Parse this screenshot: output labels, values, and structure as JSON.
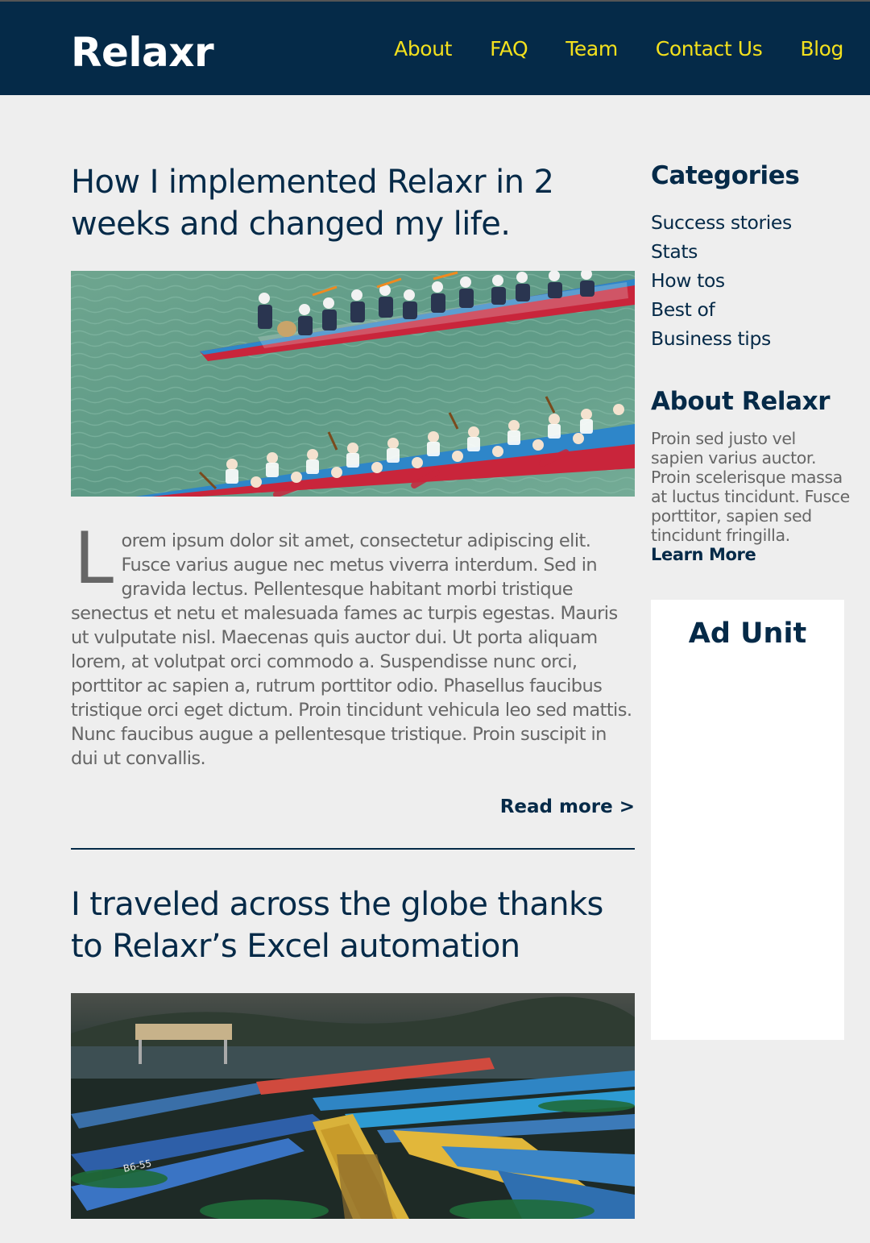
{
  "header": {
    "logo": "Relaxr",
    "nav": [
      "About",
      "FAQ",
      "Team",
      "Contact Us",
      "Blog"
    ]
  },
  "posts": [
    {
      "title": "How I implemented Relaxr in 2 weeks and changed my life.",
      "image": "dragon-boat-race-photo",
      "dropcap": "L",
      "body": "orem ipsum dolor sit amet, consectetur adipiscing elit. Fusce varius augue nec metus viverra interdum. Sed in gravida lectus. Pellentesque habitant morbi tristique senectus et netu et malesuada fames ac turpis egestas. Mauris ut vulputate nisl. Maecenas quis auctor dui. Ut porta aliquam lorem, at volutpat orci commodo a. Suspendisse nunc orci, porttitor ac sapien a, rutrum porttitor odio. Phasellus faucibus tristique orci eget dictum. Proin tincidunt vehicula leo sed mattis. Nunc faucibus augue a pellentesque tristique. Proin suscipit in dui ut convallis.",
      "read_more": "Read more >"
    },
    {
      "title": "I traveled across the globe thanks to Relaxr’s Excel automation",
      "image": "moored-rowboats-photo"
    }
  ],
  "sidebar": {
    "categories_heading": "Categories",
    "categories": [
      "Success stories",
      "Stats",
      "How tos",
      "Best of",
      "Business tips"
    ],
    "about_heading": "About Relaxr",
    "about_text": "Proin sed justo vel sapien varius auctor. Proin scelerisque massa at luctus tincidunt. Fusce porttitor, sapien sed tincidunt fringilla.",
    "learn_more": "Learn More",
    "ad_title": "Ad Unit"
  },
  "colors": {
    "navy": "#052a48",
    "nav_link": "#f3e01d",
    "background": "#eeeeee"
  }
}
